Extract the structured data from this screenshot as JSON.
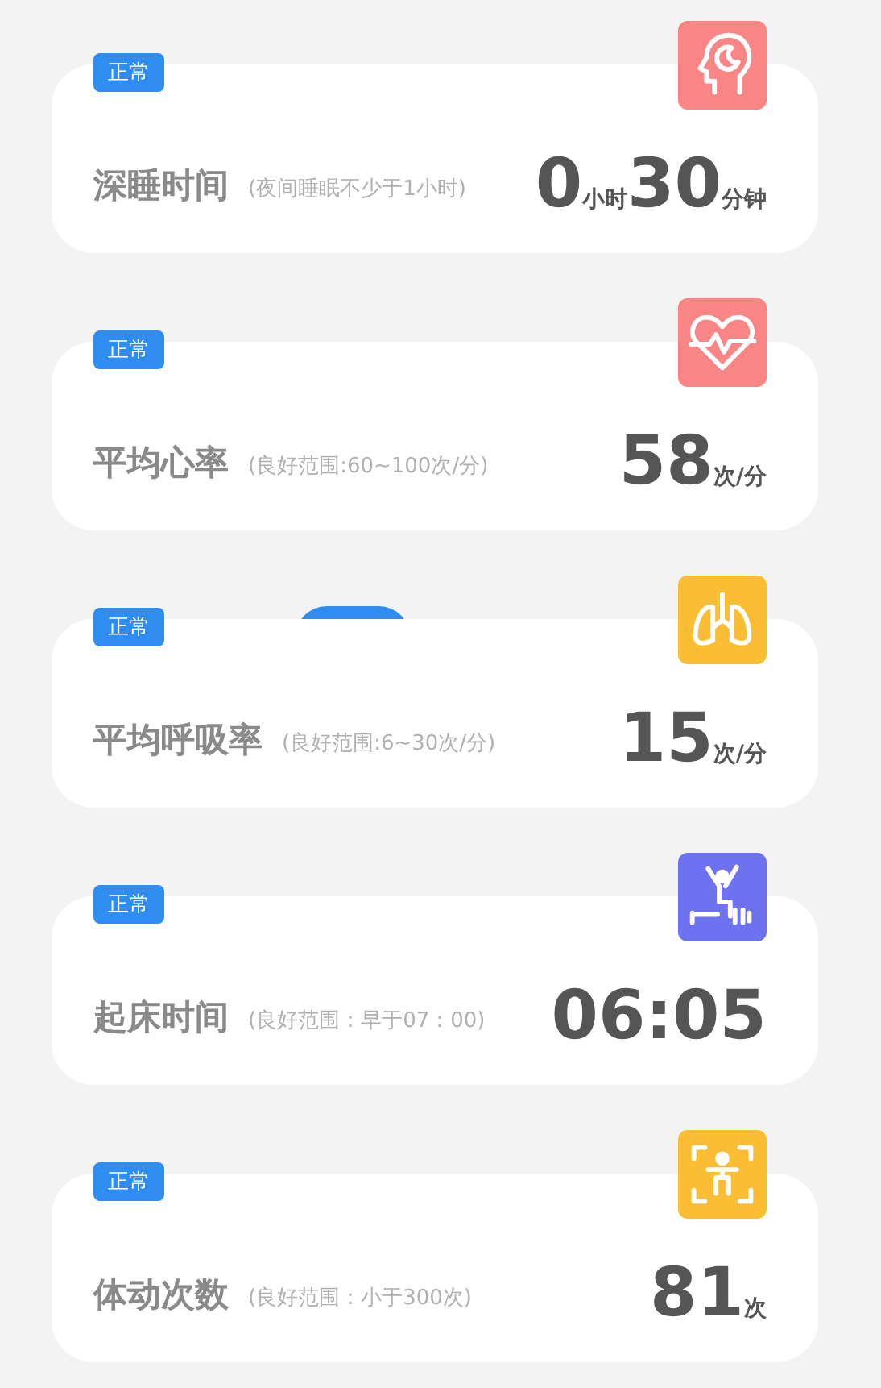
{
  "metrics": [
    {
      "badge": "正常",
      "kind": "sleep",
      "color": "#f98585",
      "title": "深睡时间",
      "hint": "(夜间睡眠不少于1小时)",
      "value": [
        {
          "kind": "num",
          "text": "0"
        },
        {
          "kind": "unit",
          "text": "小时"
        },
        {
          "kind": "num",
          "text": "30"
        },
        {
          "kind": "unit",
          "text": "分钟"
        }
      ]
    },
    {
      "badge": "正常",
      "kind": "heart",
      "color": "#f98585",
      "title": "平均心率",
      "hint": "(良好范围:60~100次/分)",
      "value": [
        {
          "kind": "num",
          "text": "58"
        },
        {
          "kind": "unit",
          "text": "次/分"
        }
      ]
    },
    {
      "badge": "正常",
      "kind": "lungs",
      "color": "#fbbd33",
      "title": "平均呼吸率",
      "hint": "(良好范围:6~30次/分)",
      "value": [
        {
          "kind": "num",
          "text": "15"
        },
        {
          "kind": "unit",
          "text": "次/分"
        }
      ]
    },
    {
      "badge": "正常",
      "kind": "wake",
      "color": "#6f72f0",
      "title": "起床时间",
      "hint": "(良好范围：早于07：00)",
      "value": [
        {
          "kind": "num",
          "text": "06:05"
        }
      ]
    },
    {
      "badge": "正常",
      "kind": "movement",
      "color": "#fbbd33",
      "title": "体动次数",
      "hint": "(良好范围：小于300次)",
      "value": [
        {
          "kind": "num",
          "text": "81"
        },
        {
          "kind": "unit",
          "text": "次"
        }
      ]
    }
  ]
}
